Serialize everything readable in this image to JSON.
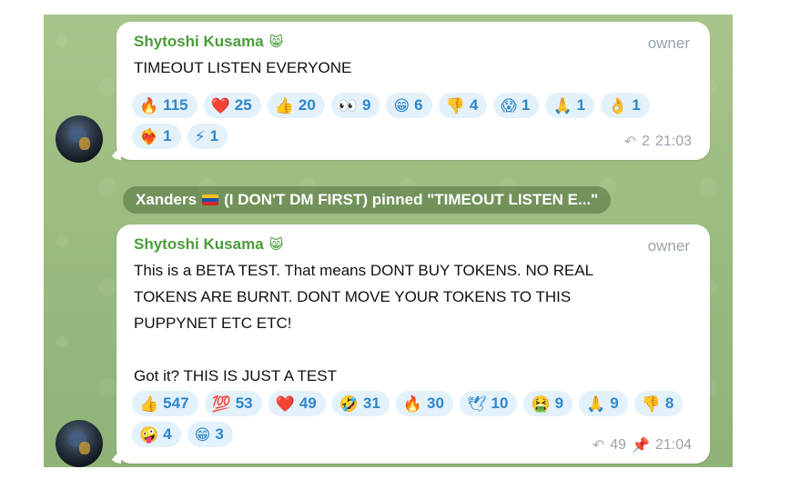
{
  "messages": [
    {
      "sender": "Shytoshi Kusama",
      "sender_emoji": "😸",
      "role": "owner",
      "text": "TIMEOUT LISTEN EVERYONE",
      "reactions": [
        {
          "emoji": "🔥",
          "count": "115"
        },
        {
          "emoji": "❤️",
          "count": "25"
        },
        {
          "emoji": "👍",
          "count": "20"
        },
        {
          "emoji": "👀",
          "count": "9"
        },
        {
          "emoji": "😁",
          "count": "6"
        },
        {
          "emoji": "👎",
          "count": "4"
        },
        {
          "emoji": "😱",
          "count": "1"
        },
        {
          "emoji": "🙏",
          "count": "1"
        },
        {
          "emoji": "👌",
          "count": "1"
        },
        {
          "emoji": "❤️‍🔥",
          "count": "1"
        },
        {
          "emoji": "⚡",
          "count": "1"
        }
      ],
      "replies": "2",
      "time": "21:03",
      "reply_icon": "reply-arrow-icon"
    },
    {
      "sender": "Shytoshi Kusama",
      "sender_emoji": "😸",
      "role": "owner",
      "text": "This is a BETA TEST. That means DONT BUY TOKENS. NO REAL\nTOKENS ARE BURNT. DONT MOVE YOUR TOKENS TO THIS\nPUPPYNET ETC ETC!\n\nGot it? THIS IS JUST A TEST",
      "reactions": [
        {
          "emoji": "👍",
          "count": "547"
        },
        {
          "emoji": "💯",
          "count": "53"
        },
        {
          "emoji": "❤️",
          "count": "49"
        },
        {
          "emoji": "🤣",
          "count": "31"
        },
        {
          "emoji": "🔥",
          "count": "30"
        },
        {
          "emoji": "🕊",
          "count": "10"
        },
        {
          "emoji": "🤮",
          "count": "9"
        },
        {
          "emoji": "🙏",
          "count": "9"
        },
        {
          "emoji": "👎",
          "count": "8"
        },
        {
          "emoji": "🤪",
          "count": "4"
        },
        {
          "emoji": "😁",
          "count": "3"
        }
      ],
      "replies": "49",
      "time": "21:04",
      "reply_icon": "reply-arrow-icon",
      "pin_icon": "pin-icon"
    }
  ],
  "service": {
    "name": "Xanders",
    "flag": "🇻🇪",
    "text": "(I DON'T DM FIRST) pinned \"TIMEOUT LISTEN E...\""
  }
}
